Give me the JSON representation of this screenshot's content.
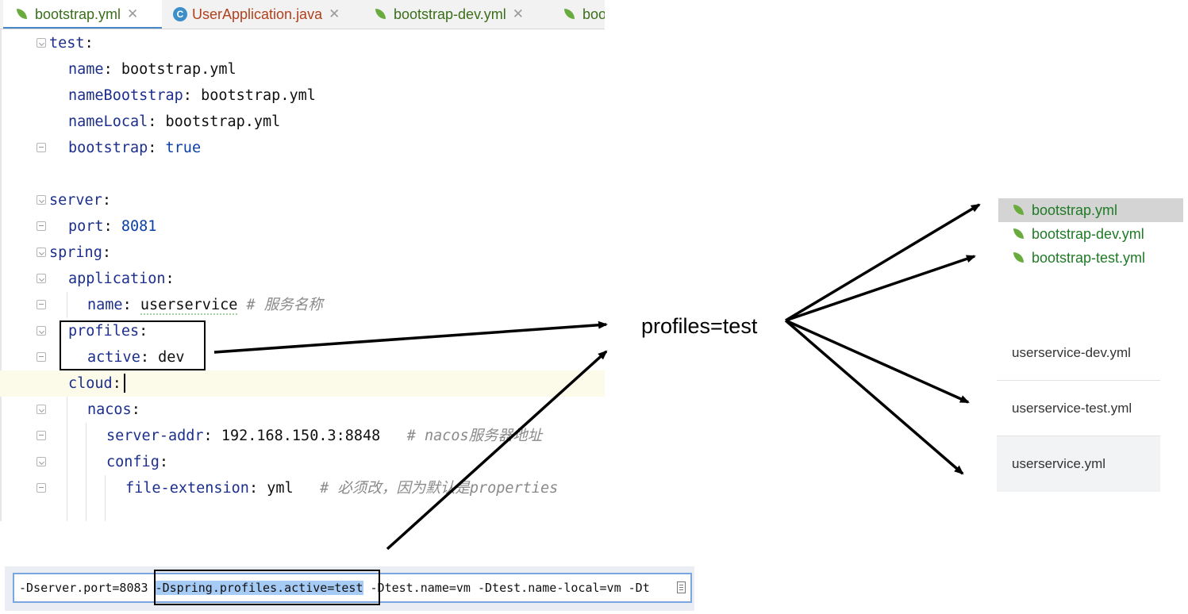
{
  "tabs": [
    {
      "label": "bootstrap.yml",
      "icon": "spring-leaf-icon",
      "active": true,
      "color": "#3a6e1a"
    },
    {
      "label": "UserApplication.java",
      "icon": "java-class-icon",
      "active": false,
      "color": "#b2401c"
    },
    {
      "label": "bootstrap-dev.yml",
      "icon": "spring-leaf-icon",
      "active": false,
      "color": "#3a6e1a"
    },
    {
      "label": "boo",
      "icon": "spring-leaf-icon",
      "active": false,
      "color": "#3a6e1a"
    }
  ],
  "code": {
    "l1_key": "test",
    "l2_key": "name",
    "l2_val": "bootstrap.yml",
    "l3_key": "nameBootstrap",
    "l3_val": "bootstrap.yml",
    "l4_key": "nameLocal",
    "l4_val": "bootstrap.yml",
    "l5_key": "bootstrap",
    "l5_val": "true",
    "l7_key": "server",
    "l8_key": "port",
    "l8_val": "8081",
    "l9_key": "spring",
    "l10_key": "application",
    "l11_key": "name",
    "l11_val": "userservice",
    "l11_comment": "# 服务名称",
    "l12_key": "profiles",
    "l13_key": "active",
    "l13_val": "dev",
    "l14_key": "cloud",
    "l15_key": "nacos",
    "l16_key": "server-addr",
    "l16_val": "192.168.150.3:8848",
    "l16_comment": "# nacos服务器地址",
    "l17_key": "config",
    "l18_key": "file-extension",
    "l18_val": "yml",
    "l18_comment": "# 必须改，因为默认是properties"
  },
  "vm_options": {
    "before": "-Dserver.port=8083 ",
    "selected": "-Dspring.profiles.active=test",
    "after": " -Dtest.name=vm -Dtest.name-local=vm -Dt"
  },
  "center_label": "profiles=test",
  "local_files": [
    {
      "name": "bootstrap.yml",
      "selected": true
    },
    {
      "name": "bootstrap-dev.yml",
      "selected": false
    },
    {
      "name": "bootstrap-test.yml",
      "selected": false
    }
  ],
  "nacos_configs": [
    {
      "name": "userservice-dev.yml"
    },
    {
      "name": "userservice-test.yml"
    },
    {
      "name": "userservice.yml"
    }
  ]
}
